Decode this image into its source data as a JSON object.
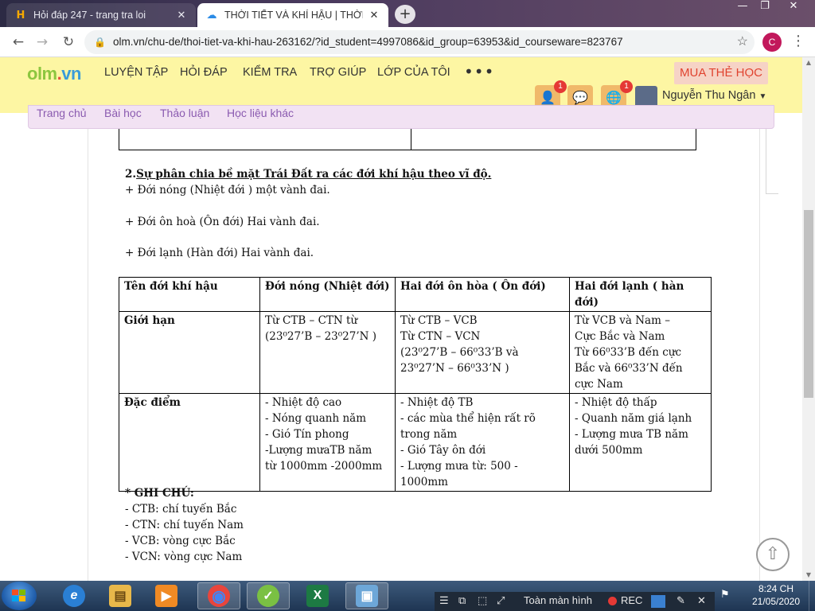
{
  "browser": {
    "tabs": [
      {
        "title": "Hỏi đáp 247 - trang tra loi",
        "icon": "H",
        "close": "✕"
      },
      {
        "title": "THỜI TIẾT VÀ KHÍ HẬU | THỜI TIẾT",
        "icon": "☁",
        "close": "✕"
      }
    ],
    "new_tab": "+",
    "window_controls": {
      "minimize": "—",
      "restore": "❐",
      "close": "✕"
    },
    "back": "←",
    "forward": "→",
    "reload": "↻",
    "url": "olm.vn/chu-de/thoi-tiet-va-khi-hau-263162/?id_student=4997086&id_group=63953&id_courseware=823767",
    "lock": "🔒",
    "bookmark": "☆",
    "profile_initial": "C",
    "menu_dots": "⋮"
  },
  "site": {
    "logo": {
      "part1": "olm",
      "part2": ".",
      "part3": "vn"
    },
    "menu": [
      "LUYỆN TẬP",
      "HỎI ĐÁP",
      "KIỂM TRA",
      "TRỢ GIÚP",
      "LỚP CỦA TÔI"
    ],
    "more": "•••",
    "buy_button": "MUA THẺ HỌC",
    "badges": {
      "friend": "1",
      "world": "1"
    },
    "user_name": "Nguyễn Thu Ngân",
    "user_caret": "▼",
    "subnav": [
      "Trang chủ",
      "Bài học",
      "Thảo luận",
      "Học liệu khác"
    ]
  },
  "document": {
    "heading_num": "2.",
    "heading_text": "Sự phân chia bề mặt Trái Đất  ra các đới khí hậu theo vĩ độ.",
    "lines": [
      " + Đới nóng (Nhiệt đới ) một vành đai.",
      "+ Đới ôn hoà (Ôn đới) Hai vành đai.",
      "+ Đới lạnh  (Hàn đới)  Hai vành đai."
    ],
    "table": {
      "headers": [
        "Tên đới khí hậu",
        "Đới nóng (Nhiệt đới)",
        "Hai đới ôn hòa ( Ôn đới)",
        "Hai đới lạnh ( hàn đới)"
      ],
      "rows": [
        {
          "label": "Giới hạn",
          "cells": [
            [
              "Từ CTB – CTN từ",
              "(23⁰27’B – 23⁰27’N )"
            ],
            [
              "Từ CTB – VCB",
              "Từ CTN – VCN",
              "(23⁰27’B – 66⁰33’B và",
              "23⁰27’N – 66⁰33’N )"
            ],
            [
              "Từ   VCB và Nam –",
              "Cực Bắc và Nam",
              "Từ 66⁰33’B đến cực",
              "Bắc và 66⁰33’N đến",
              "cực Nam"
            ]
          ]
        },
        {
          "label": "Đặc điểm",
          "cells": [
            [
              "- Nhiệt độ cao",
              "- Nóng quanh năm",
              "- Gió Tín phong",
              "-Lượng  mưaTB  năm",
              "từ 1000mm -2000mm"
            ],
            [
              "- Nhiệt độ TB",
              "- các mùa thể hiện rất rõ",
              "trong năm",
              "- Gió Tây ôn đới",
              "- Lượng mưa từ: 500 -",
              "1000mm"
            ],
            [
              "- Nhiệt độ thấp",
              "- Quanh năm giá lạnh",
              "- Lượng  mưa TB năm",
              "dưới 500mm"
            ]
          ]
        }
      ]
    },
    "notes_title": "* GHI CHÚ:",
    "notes": [
      "- CTB: chí tuyến Bắc",
      "- CTN: chí tuyến Nam",
      "- VCB: vòng cực Bắc",
      "- VCN: vòng cực Nam"
    ]
  },
  "scroll_to_top": "⇧",
  "taskbar": {
    "apps": [
      {
        "name": "ie",
        "glyph": "e"
      },
      {
        "name": "explorer",
        "glyph": "▤"
      },
      {
        "name": "media",
        "glyph": "▶"
      },
      {
        "name": "chrome",
        "glyph": "◉"
      },
      {
        "name": "olm-app",
        "glyph": "✓"
      },
      {
        "name": "excel",
        "glyph": "X"
      },
      {
        "name": "photos",
        "glyph": "▣"
      }
    ],
    "recorder_label": "Toàn màn hình",
    "recorder_rec": "REC",
    "recorder_icons": [
      "☰",
      "⧉",
      "⬚",
      "⤢"
    ],
    "recorder_tools": [
      "✎",
      "✕"
    ],
    "tray_icon": "⚑",
    "time": "8:24 CH",
    "date": "21/05/2020"
  }
}
